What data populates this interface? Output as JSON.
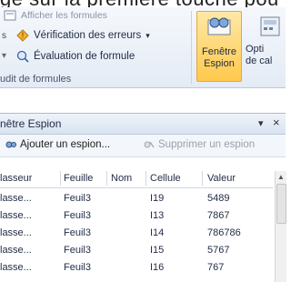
{
  "top_text": "ge sur la première touche pou",
  "ribbon": {
    "show_formulas_label": "Afficher les formules",
    "error_check_label": "Vérification des erreurs",
    "error_check_arrow": "▾",
    "evaluate_label": "Évaluation de formule",
    "group_label": "udit de formules",
    "watch_window_line1": "Fenêtre",
    "watch_window_line2": "Espion",
    "options_line1": "Opti",
    "options_line2": "de cal"
  },
  "pane": {
    "title": "nêtre Espion",
    "pin_glyph": "▾",
    "close_glyph": "×",
    "add_watch_label": "Ajouter un espion...",
    "delete_watch_label": "Supprimer un espion",
    "columns": [
      "lasseur",
      "Feuille",
      "Nom",
      "Cellule",
      "Valeur"
    ],
    "rows": [
      {
        "classeur": "lasse...",
        "feuille": "Feuil3",
        "nom": "",
        "cellule": "I19",
        "valeur": "5489"
      },
      {
        "classeur": "lasse...",
        "feuille": "Feuil3",
        "nom": "",
        "cellule": "I13",
        "valeur": "7867"
      },
      {
        "classeur": "lasse...",
        "feuille": "Feuil3",
        "nom": "",
        "cellule": "I14",
        "valeur": "786786"
      },
      {
        "classeur": "lasse...",
        "feuille": "Feuil3",
        "nom": "",
        "cellule": "I15",
        "valeur": "5767"
      },
      {
        "classeur": "lasse...",
        "feuille": "Feuil3",
        "nom": "",
        "cellule": "I16",
        "valeur": "767"
      }
    ]
  },
  "colors": {
    "active_button": "#ffc94d",
    "pane_header": "#d9e3f0"
  }
}
